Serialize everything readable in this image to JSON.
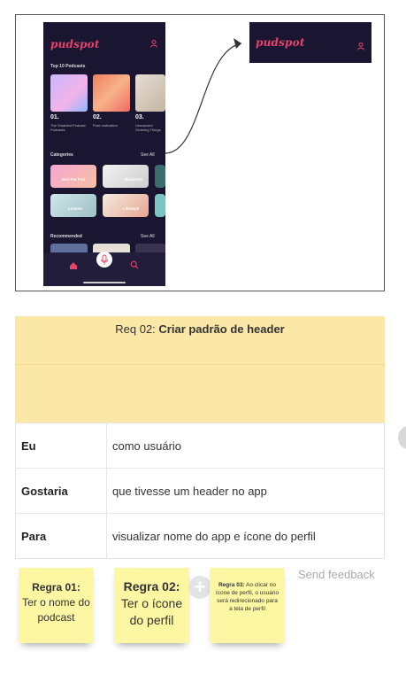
{
  "mockup": {
    "app_name": "pudspot",
    "top_section": "Top 10 Podcasts",
    "top_items": [
      {
        "num": "01.",
        "caption": "The Smartest Podcast Podcasts"
      },
      {
        "num": "02.",
        "caption": "Pure motivation"
      },
      {
        "num": "03.",
        "caption": "Unmanned Ordering Things"
      }
    ],
    "categories_title": "Categories",
    "recommended_title": "Recommended",
    "see_all": "See All",
    "categories": [
      "Just For Fun",
      "Business",
      "Leisure",
      "Lifestyle"
    ],
    "header_app_name": "pudspot"
  },
  "requirement": {
    "title_prefix": "Req 02: ",
    "title_bold": "Criar padrão de header",
    "rows": [
      {
        "key": "Eu",
        "value": "como usuário"
      },
      {
        "key": "Gostaria",
        "value": "que tivesse um header no app"
      },
      {
        "key": "Para",
        "value": "visualizar nome do app e ícone do perfil"
      }
    ]
  },
  "stickies": [
    {
      "bold": "Regra 01:",
      "text": "Ter o nome do podcast"
    },
    {
      "bold": "Regra 02:",
      "text": "Ter o ícone do perfil"
    },
    {
      "bold": "Regra 03:",
      "text": "Ao clicar no ícone de perfil, o usuário será redirecionado para a tela de perfil"
    }
  ],
  "feedback_label": "Send feedback",
  "colors": {
    "brand": "#e8436b",
    "dark_bg": "#1a1631",
    "sticky": "#fdf6a3",
    "card_header": "#fbe8a6"
  }
}
